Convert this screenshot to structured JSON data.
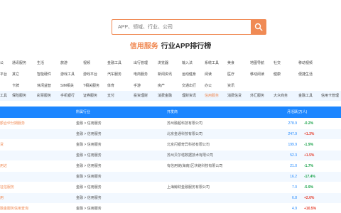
{
  "search": {
    "placeholder": "APP、领域、行业、公司"
  },
  "headline": {
    "accent": "信用服务",
    "title": "行业APP排行榜"
  },
  "categories": [
    [
      "公",
      "通讯服务",
      "生活",
      "旅游",
      "视频",
      "金融工具",
      "出行管理",
      "浏览器",
      "输入法",
      "系统工具",
      "美食",
      "地图导航",
      "社交",
      "移动视频"
    ],
    [
      "平台",
      "其它",
      "智能硬件",
      "游戏工具",
      "游戏平台",
      "汽车服务",
      "电商服务",
      "新闻资讯",
      "运动健身",
      "阅读",
      "医疗",
      "移动阅读",
      "健康",
      "便捷生活"
    ],
    [
      "",
      "卡牌",
      "休闲益智",
      "SIM相关",
      "T相关服务",
      "体育",
      "手游",
      "房产",
      "交通出行",
      "办公",
      "资讯",
      "",
      "",
      ""
    ],
    [
      "工具",
      "保险服务",
      "彩票服务",
      "手机银行",
      "证券服务",
      "支付",
      "投资理财",
      "消费金融",
      "理财资讯",
      "信用服务",
      "消费信贷",
      "外汇服务",
      "大众商务",
      "金融工具",
      "信用卡管理"
    ]
  ],
  "table": {
    "headers": {
      "category": "所属行业",
      "developer": "开发商",
      "value": "月活跃(万人)"
    },
    "rows": [
      {
        "app": "额合伙分期服务",
        "category": "金融 > 信用服务",
        "developer": "苏州融超科技有限公司",
        "value": "278.9",
        "change": "-0.2%",
        "direction": "down"
      },
      {
        "app": "",
        "category": "金融 > 信用服务",
        "developer": "北京金通科技有限公司",
        "value": "247.9",
        "change": "+1.3%",
        "direction": "up"
      },
      {
        "app": "贷",
        "category": "金融 > 信用服务",
        "developer": "北京闪银奇异科技有限公司",
        "value": "199.9",
        "change": "-1.9%",
        "direction": "down"
      },
      {
        "app": "",
        "category": "金融 > 信用服务",
        "developer": "苏州贝尔塔数据技术有限公司",
        "value": "52.3",
        "change": "+1.5%",
        "direction": "up"
      },
      {
        "app": "用达",
        "category": "金融 > 信用服务",
        "developer": "有信用链(海南)区块链科技有限公司",
        "value": "21.0",
        "change": "-1.7%",
        "direction": "down"
      },
      {
        "app": "",
        "category": "金融 > 信用服务",
        "developer": "",
        "value": "16.2",
        "change": "-17.4%",
        "direction": "down"
      },
      {
        "app": "征信服务",
        "category": "金融 > 信用服务",
        "developer": "上海鲸财金融服务有限公司",
        "value": "7.0",
        "change": "-5.9%",
        "direction": "down"
      },
      {
        "app": "用",
        "category": "金融 > 信用服务",
        "developer": "",
        "value": "6.8",
        "change": "+2.6%",
        "direction": "up"
      },
      {
        "app": "融金服务信用查询",
        "category": "金融 > 信用服务",
        "developer": "",
        "value": "4.9",
        "change": "+10.5%",
        "direction": "up"
      }
    ]
  },
  "colors": {
    "accent": "#f08a54",
    "header_blue": "#1c86ff",
    "up": "#e5402f",
    "down": "#1aa34a"
  }
}
